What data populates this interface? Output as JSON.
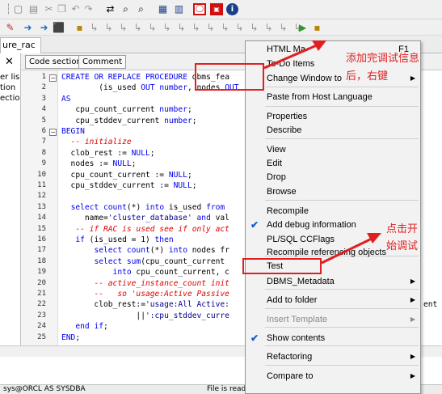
{
  "document_tab": "ure_rac",
  "left_panel": {
    "close_glyph": "✕",
    "items": [
      "er lis",
      "tion",
      "ection"
    ]
  },
  "editor_tabs": [
    "Code section",
    "Comment"
  ],
  "editor": {
    "line_numbers": [
      "1",
      "2",
      "3",
      "4",
      "5",
      "6",
      "7",
      "8",
      "9",
      "10",
      "11",
      "12",
      "13",
      "14",
      "15",
      "16",
      "17",
      "18",
      "19",
      "20",
      "21",
      "22",
      "23",
      "24",
      "25"
    ],
    "lines": [
      "CREATE OR REPLACE PROCEDURE dbms_fea",
      "        (is_used OUT number, nodes OUT",
      "AS",
      "   cpu_count_current number;",
      "   cpu_stddev_current number;",
      "BEGIN",
      "  -- initialize",
      "  clob_rest := NULL;",
      "  nodes := NULL;",
      "  cpu_count_current := NULL;",
      "  cpu_stddev_current := NULL;",
      "",
      "  select count(*) into is_used from",
      "     name='cluster_database' and val",
      "   -- if RAC is used see if only act",
      "   if (is_used = 1) then",
      "       select count(*) into nodes fr",
      "       select sum(cpu_count_current",
      "           into cpu_count_current, c",
      "       -- active_instance_count init",
      "       --   so 'usage:Active Passive",
      "       clob_rest:='usage:All Active:",
      "                ||':cpu_stddev_curre",
      "   end if;",
      "END;"
    ],
    "right_tail": "ent"
  },
  "statusbar": {
    "left": "sys@ORCL AS SYSDBA",
    "right": "File is read"
  },
  "context_menu": {
    "items": [
      {
        "label": "HTML Ma",
        "shortcut": "F1",
        "arrow": false,
        "check": false,
        "disabled": false
      },
      {
        "label": "To-Do Items",
        "shortcut": "",
        "arrow": false,
        "check": false,
        "disabled": false
      },
      {
        "label": "Change Window to",
        "shortcut": "",
        "arrow": true,
        "check": false,
        "disabled": false
      },
      {
        "label": "Paste from Host Language",
        "shortcut": "",
        "arrow": false,
        "check": false,
        "disabled": false
      },
      {
        "label": "Properties",
        "shortcut": "",
        "arrow": false,
        "check": false,
        "disabled": false
      },
      {
        "label": "Describe",
        "shortcut": "",
        "arrow": false,
        "check": false,
        "disabled": false
      },
      {
        "label": "View",
        "shortcut": "",
        "arrow": false,
        "check": false,
        "disabled": false
      },
      {
        "label": "Edit",
        "shortcut": "",
        "arrow": false,
        "check": false,
        "disabled": false
      },
      {
        "label": "Drop",
        "shortcut": "",
        "arrow": false,
        "check": false,
        "disabled": false
      },
      {
        "label": "Browse",
        "shortcut": "",
        "arrow": false,
        "check": false,
        "disabled": false
      },
      {
        "label": "Recompile",
        "shortcut": "",
        "arrow": false,
        "check": false,
        "disabled": false
      },
      {
        "label": "Add debug information",
        "shortcut": "",
        "arrow": false,
        "check": true,
        "disabled": false
      },
      {
        "label": "PL/SQL CCFlags",
        "shortcut": "",
        "arrow": false,
        "check": false,
        "disabled": false
      },
      {
        "label": "Recompile referencing objects",
        "shortcut": "",
        "arrow": false,
        "check": false,
        "disabled": false
      },
      {
        "label": "Test",
        "shortcut": "",
        "arrow": false,
        "check": false,
        "disabled": false
      },
      {
        "label": "DBMS_Metadata",
        "shortcut": "",
        "arrow": true,
        "check": false,
        "disabled": false
      },
      {
        "label": "Add to folder",
        "shortcut": "",
        "arrow": true,
        "check": false,
        "disabled": false
      },
      {
        "label": "Insert Template",
        "shortcut": "",
        "arrow": true,
        "check": false,
        "disabled": true
      },
      {
        "label": "Show contents",
        "shortcut": "",
        "arrow": false,
        "check": true,
        "disabled": false
      },
      {
        "label": "Refactoring",
        "shortcut": "",
        "arrow": true,
        "check": false,
        "disabled": false
      },
      {
        "label": "Compare to",
        "shortcut": "",
        "arrow": true,
        "check": false,
        "disabled": false
      }
    ],
    "arrow_glyph": "▶",
    "check_glyph": "✔"
  },
  "annotations": {
    "note1_line1": "添加完调试信息",
    "note1_line2": "后，右键",
    "note2_line1": "点击开",
    "note2_line2": "始调试",
    "color": "#e02020"
  },
  "colors": {
    "keyword": "#0000ee",
    "comment": "#e00000",
    "string": "#00008b",
    "menu_bg": "#f2f2f2",
    "check": "#1a5fd0"
  },
  "icons": {
    "toolbar1": [
      "cut-icon",
      "copy-icon",
      "paste-icon",
      "undo-icon",
      "redo-icon",
      "replace-icon",
      "find-icon",
      "find-next-icon",
      "window-list-icon",
      "window-tile-icon",
      "session-icon",
      "oracle-icon",
      "pdf-icon",
      "help-icon"
    ],
    "toolbar2": [
      "save-icon",
      "run-back-icon",
      "run-forward-icon",
      "stop-icon",
      "car-icon",
      "debug-step-icons",
      "debug-run-icon",
      "debug-stop-icon"
    ]
  }
}
